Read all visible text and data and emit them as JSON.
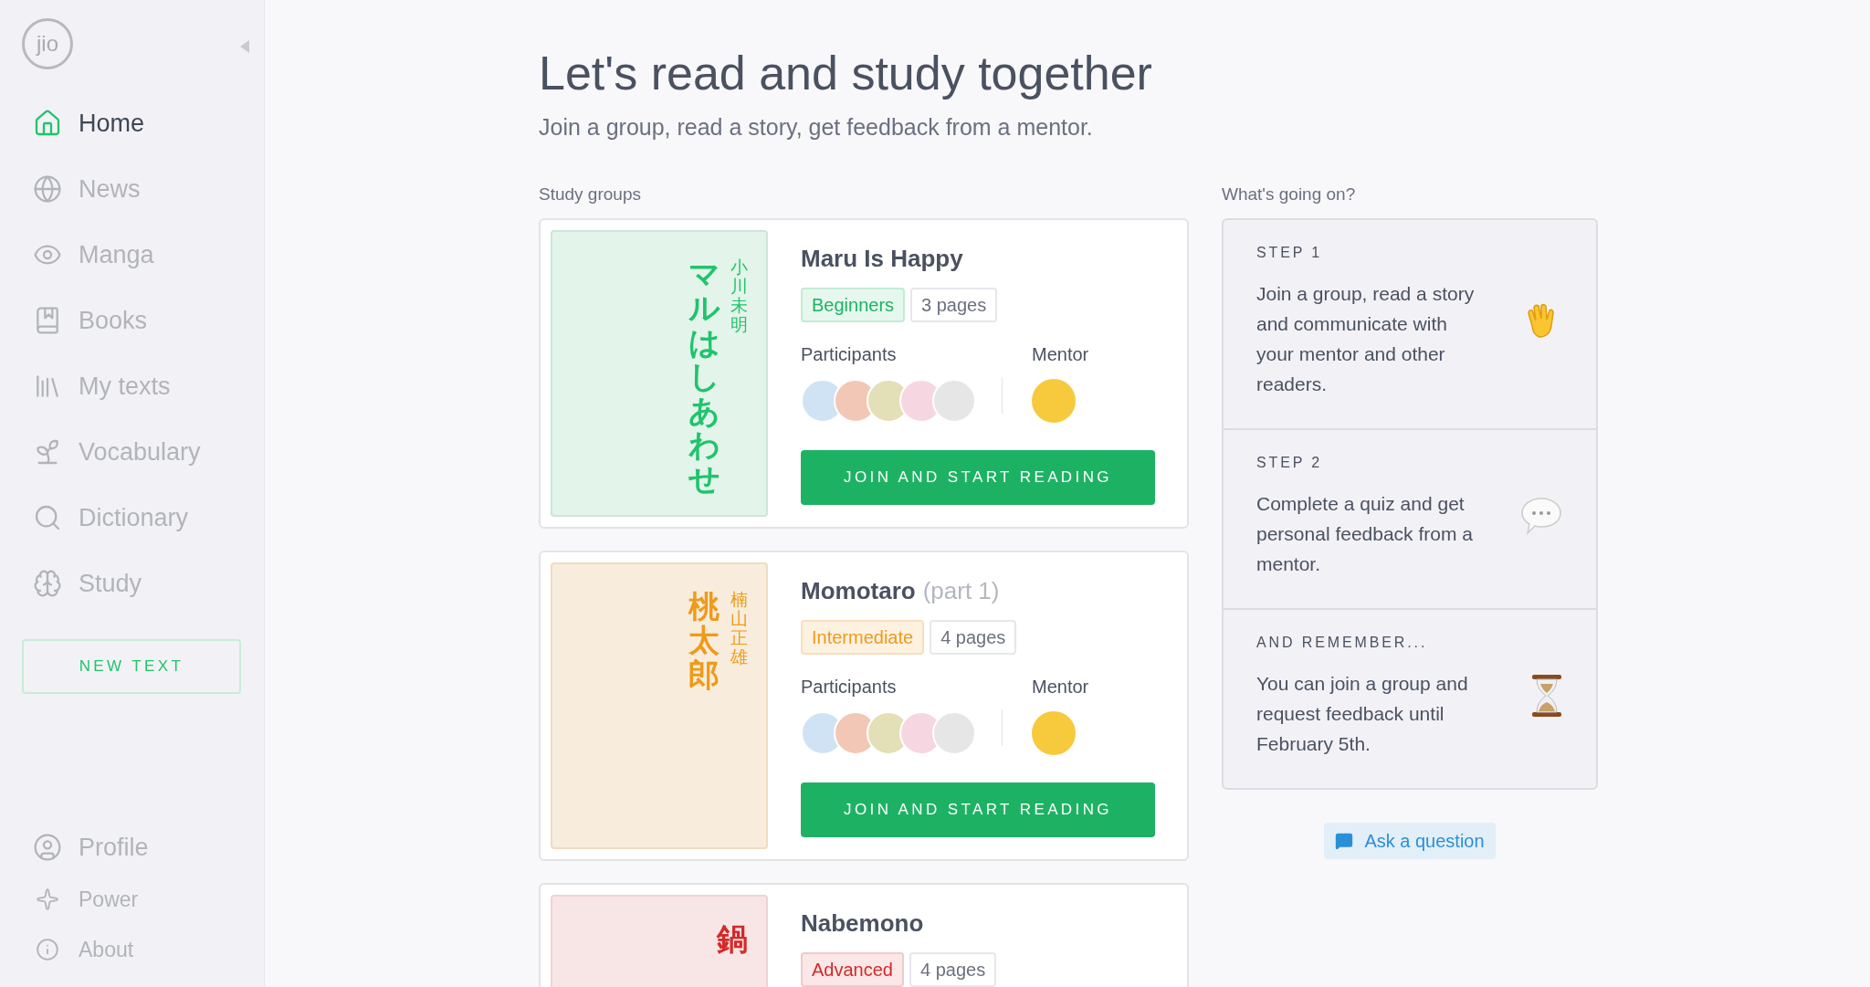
{
  "sidebar": {
    "logo": "jio",
    "items": [
      {
        "label": "Home",
        "selected": true
      },
      {
        "label": "News",
        "selected": false
      },
      {
        "label": "Manga",
        "selected": false
      },
      {
        "label": "Books",
        "selected": false
      },
      {
        "label": "My texts",
        "selected": false
      },
      {
        "label": "Vocabulary",
        "selected": false
      },
      {
        "label": "Dictionary",
        "selected": false
      },
      {
        "label": "Study",
        "selected": false
      }
    ],
    "new_text_button": "NEW TEXT",
    "bottom_items": [
      {
        "label": "Profile"
      },
      {
        "label": "Power"
      },
      {
        "label": "About"
      }
    ]
  },
  "header": {
    "title": "Let's read and study together",
    "subtitle": "Join a group, read a story, get feedback from a mentor."
  },
  "study_groups": {
    "label": "Study groups",
    "cards": [
      {
        "title": "Maru Is Happy",
        "level": "Beginners",
        "kind": "beginner",
        "pages": "3 pages",
        "cover_title": "マルはしあわせ",
        "cover_author": "小川未明",
        "participants_label": "Participants",
        "mentor_label": "Mentor",
        "button": "JOIN AND START READING"
      },
      {
        "title": "Momotaro",
        "suffix": "(part 1)",
        "level": "Intermediate",
        "kind": "intermediate",
        "pages": "4 pages",
        "cover_title": "桃太郎",
        "cover_author": "楠山正雄",
        "participants_label": "Participants",
        "mentor_label": "Mentor",
        "button": "JOIN AND START READING"
      },
      {
        "title": "Nabemono",
        "level": "Advanced",
        "kind": "advanced",
        "pages": "4 pages",
        "cover_title": "鍋"
      }
    ]
  },
  "whats_going_on": {
    "label": "What's going on?",
    "steps": [
      {
        "heading": "STEP 1",
        "text": "Join a group, read a story and communicate with your mentor and other readers."
      },
      {
        "heading": "STEP 2",
        "text": "Complete a quiz and get personal feedback from a mentor."
      },
      {
        "heading": "AND REMEMBER...",
        "text": "You can join a group and request feedback until February 5th."
      }
    ],
    "ask_button": "Ask a question"
  }
}
